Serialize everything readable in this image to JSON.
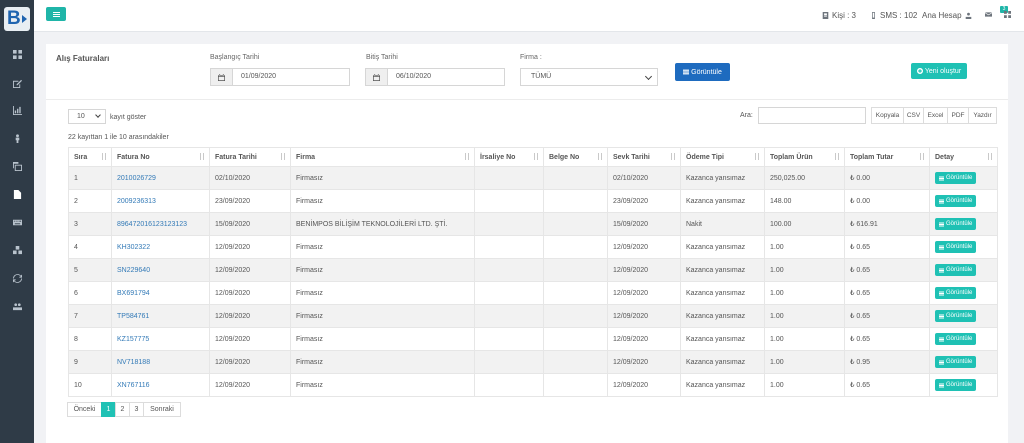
{
  "topbar": {
    "people": "Kişi : 3",
    "sms": "SMS : 102",
    "account": "Ana Hesap",
    "notify_count": "3"
  },
  "filters": {
    "title": "Alış Faturaları",
    "start_label": "Başlangıç Tarihi",
    "start_value": "01/09/2020",
    "end_label": "Bitiş Tarihi",
    "end_value": "06/10/2020",
    "firm_label": "Firma :",
    "firm_value": "TÜMÜ",
    "view_button": "Görüntüle",
    "new_button": "Yeni oluştur"
  },
  "table_controls": {
    "length_value": "10",
    "length_label": "kayıt göster",
    "info": "22 kayıttan 1 ile 10 arasındakiler",
    "search_label": "Ara:",
    "exports": [
      "Kopyala",
      "CSV",
      "Excel",
      "PDF",
      "Yazdır"
    ]
  },
  "columns": [
    "Sıra",
    "Fatura No",
    "Fatura Tarihi",
    "Firma",
    "İrsaliye No",
    "Belge No",
    "Sevk Tarihi",
    "Ödeme Tipi",
    "Toplam Ürün",
    "Toplam Tutar",
    "Detay"
  ],
  "rows": [
    {
      "sira": "1",
      "fatura_no": "2010026729",
      "fatura_tarihi": "02/10/2020",
      "firma": "Firmasız",
      "irsaliye": "",
      "belge": "",
      "sevk": "02/10/2020",
      "odeme": "Kazanca yansımaz",
      "urun": "250,025.00",
      "tutar": "₺ 0.00"
    },
    {
      "sira": "2",
      "fatura_no": "2009236313",
      "fatura_tarihi": "23/09/2020",
      "firma": "Firmasız",
      "irsaliye": "",
      "belge": "",
      "sevk": "23/09/2020",
      "odeme": "Kazanca yansımaz",
      "urun": "148.00",
      "tutar": "₺ 0.00"
    },
    {
      "sira": "3",
      "fatura_no": "896472016123123123",
      "fatura_tarihi": "15/09/2020",
      "firma": "BENİMPOS BİLİŞİM TEKNOLOJİLERİ LTD. ŞTİ.",
      "irsaliye": "",
      "belge": "",
      "sevk": "15/09/2020",
      "odeme": "Nakit",
      "urun": "100.00",
      "tutar": "₺ 616.91"
    },
    {
      "sira": "4",
      "fatura_no": "KH302322",
      "fatura_tarihi": "12/09/2020",
      "firma": "Firmasız",
      "irsaliye": "",
      "belge": "",
      "sevk": "12/09/2020",
      "odeme": "Kazanca yansımaz",
      "urun": "1.00",
      "tutar": "₺ 0.65"
    },
    {
      "sira": "5",
      "fatura_no": "SN229640",
      "fatura_tarihi": "12/09/2020",
      "firma": "Firmasız",
      "irsaliye": "",
      "belge": "",
      "sevk": "12/09/2020",
      "odeme": "Kazanca yansımaz",
      "urun": "1.00",
      "tutar": "₺ 0.65"
    },
    {
      "sira": "6",
      "fatura_no": "BX691794",
      "fatura_tarihi": "12/09/2020",
      "firma": "Firmasız",
      "irsaliye": "",
      "belge": "",
      "sevk": "12/09/2020",
      "odeme": "Kazanca yansımaz",
      "urun": "1.00",
      "tutar": "₺ 0.65"
    },
    {
      "sira": "7",
      "fatura_no": "TP584761",
      "fatura_tarihi": "12/09/2020",
      "firma": "Firmasız",
      "irsaliye": "",
      "belge": "",
      "sevk": "12/09/2020",
      "odeme": "Kazanca yansımaz",
      "urun": "1.00",
      "tutar": "₺ 0.65"
    },
    {
      "sira": "8",
      "fatura_no": "KZ157775",
      "fatura_tarihi": "12/09/2020",
      "firma": "Firmasız",
      "irsaliye": "",
      "belge": "",
      "sevk": "12/09/2020",
      "odeme": "Kazanca yansımaz",
      "urun": "1.00",
      "tutar": "₺ 0.65"
    },
    {
      "sira": "9",
      "fatura_no": "NV718188",
      "fatura_tarihi": "12/09/2020",
      "firma": "Firmasız",
      "irsaliye": "",
      "belge": "",
      "sevk": "12/09/2020",
      "odeme": "Kazanca yansımaz",
      "urun": "1.00",
      "tutar": "₺ 0.95"
    },
    {
      "sira": "10",
      "fatura_no": "XN767116",
      "fatura_tarihi": "12/09/2020",
      "firma": "Firmasız",
      "irsaliye": "",
      "belge": "",
      "sevk": "12/09/2020",
      "odeme": "Kazanca yansımaz",
      "urun": "1.00",
      "tutar": "₺ 0.65"
    }
  ],
  "detail_button": "Görüntüle",
  "pagination": {
    "prev": "Önceki",
    "pages": [
      "1",
      "2",
      "3"
    ],
    "next": "Sonraki"
  },
  "colors": {
    "teal": "#1fc1b4",
    "blue": "#1e6bbf",
    "sidebar": "#2f3b47",
    "link": "#337ab7"
  }
}
